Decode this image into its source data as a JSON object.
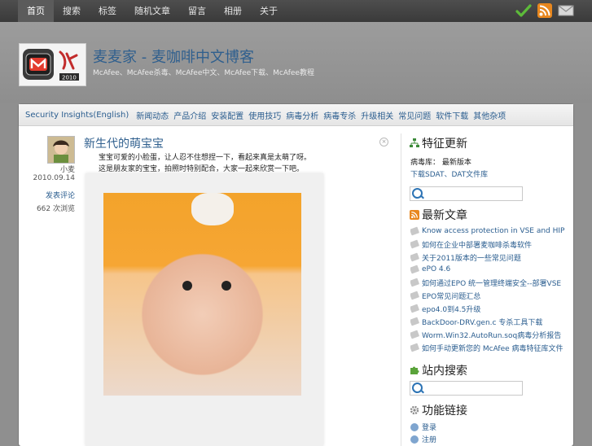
{
  "topnav": [
    "首页",
    "搜索",
    "标签",
    "随机文章",
    "留言",
    "相册",
    "关于"
  ],
  "topicons": [
    "checkmark-icon",
    "rss-icon",
    "mail-icon"
  ],
  "site": {
    "title": "麦麦家 - 麦咖啡中文博客",
    "description": "McAfee、McAfee杀毒、McAfee中文、McAfee下载、McAfee教程"
  },
  "categories": [
    "Security Insights(English)",
    "新闻动态",
    "产品介绍",
    "安装配置",
    "使用技巧",
    "病毒分析",
    "病毒专杀",
    "升级相关",
    "常见问题",
    "软件下载",
    "其他杂项"
  ],
  "post": {
    "title": "新生代的萌宝宝",
    "author": "小麦",
    "date": "2010.09.14",
    "comments_link": "发表评论",
    "views": "662 次浏览",
    "line1": "宝宝可爱的小脸蛋，让人忍不住想捏一下，看起来真是太萌了呀。",
    "line2": "这是朋友家的宝宝，拍照时特别配合，大家一起来欣赏一下吧。"
  },
  "sidebar": {
    "update_title": "特征更新",
    "update_text": "病毒库： 最新版本",
    "update_link": "下载SDAT、DAT文件库",
    "recent_title": "最新文章",
    "recent": [
      "Know access protection in VSE and HIPS",
      "如何在企业中部署麦咖啡杀毒软件",
      "关于2011版本的一些常见问题",
      "ePO 4.6",
      "如何通过EPO 统一管理终端安全--部署VSE",
      "EPO常见问题汇总",
      "epo4.0到4.5升级",
      "BackDoor-DRV.gen.c 专杀工具下载",
      "Worm.Win32.AutoRun.soq病毒分析报告",
      "如何手动更新您的 McAfee 病毒特征库文件"
    ],
    "search_title": "站内搜索",
    "links_title": "功能链接",
    "links": [
      "登录",
      "注册"
    ]
  },
  "colors": {
    "link": "#2a5d8f",
    "title": "#2f5f8e",
    "background": "#8f8f8f"
  }
}
